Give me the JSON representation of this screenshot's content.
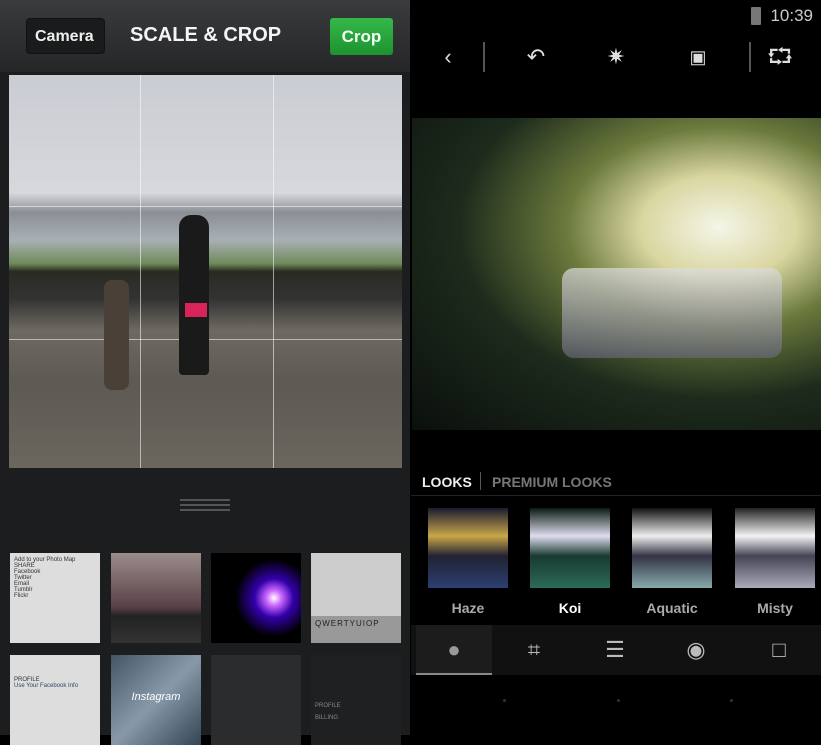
{
  "left": {
    "back_label": "Camera",
    "title": "SCALE & CROP",
    "crop_label": "Crop",
    "thumbs": [
      {
        "lines": [
          "Add to your Photo Map",
          "SHARE",
          "Facebook",
          "Twitter",
          "Email",
          "Tumblr",
          "Flickr"
        ]
      },
      {
        "lines": []
      },
      {
        "lines": []
      },
      {
        "lines": [
          "QWERTYUIOP"
        ]
      },
      {
        "lines": [
          "PROFILE",
          "Use Your Facebook Info"
        ]
      },
      {
        "lines": [
          "Instagram"
        ]
      },
      {
        "lines": []
      },
      {
        "lines": [
          "PROFILE",
          "BILLING"
        ]
      }
    ]
  },
  "right": {
    "status": {
      "time": "10:39"
    },
    "toolbar": [
      "back-icon",
      "undo-icon",
      "magic-wand-icon",
      "gallery-icon",
      "share-icon"
    ],
    "tabs": {
      "looks": "LOOKS",
      "premium": "PREMIUM LOOKS"
    },
    "looks": [
      {
        "label": "Haze"
      },
      {
        "label": "Koi",
        "selected": true
      },
      {
        "label": "Aquatic"
      },
      {
        "label": "Misty"
      }
    ],
    "bottom_tools": [
      "looks-icon",
      "crop-icon",
      "adjust-icon",
      "red-eye-icon",
      "frame-icon"
    ]
  },
  "colors": {
    "crop_green": "#2aa63d",
    "selected_label": "#ffffff"
  }
}
